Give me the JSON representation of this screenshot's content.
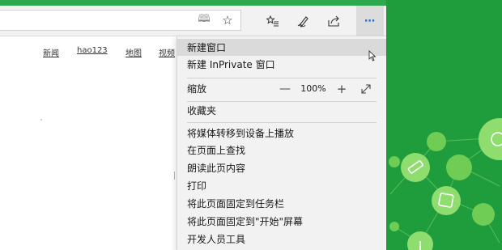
{
  "toolbar": {
    "address_value": "",
    "reading_view_icon": "book-icon",
    "favorite_icon": "star-outline-icon",
    "hub_icon": "favorites-hub-icon",
    "note_icon": "pen-icon",
    "share_icon": "share-icon",
    "more_icon": "ellipsis-icon"
  },
  "page": {
    "links": [
      "新闻",
      "hao123",
      "地图",
      "视频"
    ]
  },
  "menu": {
    "items_group1": [
      {
        "label": "新建窗口"
      },
      {
        "label": "新建 InPrivate 窗口"
      }
    ],
    "zoom": {
      "label": "缩放",
      "minus": "—",
      "value": "100%",
      "plus": "+",
      "fullscreen_icon": "expand-arrows-icon"
    },
    "favorites": "收藏夹",
    "items_group2": [
      {
        "label": "将媒体转移到设备上播放"
      },
      {
        "label": "在页面上查找"
      },
      {
        "label": "朗读此页内容"
      },
      {
        "label": "打印"
      },
      {
        "label": "将此页面固定到任务栏"
      },
      {
        "label": "将此页面固定到\"开始\"屏幕"
      },
      {
        "label": "开发人员工具"
      }
    ]
  },
  "colors": {
    "title_green": "#2ea84d",
    "wallpaper_green": "#1f9d3c",
    "menu_bg": "#f2f2f2",
    "accent_blue": "#1f6fc9"
  }
}
